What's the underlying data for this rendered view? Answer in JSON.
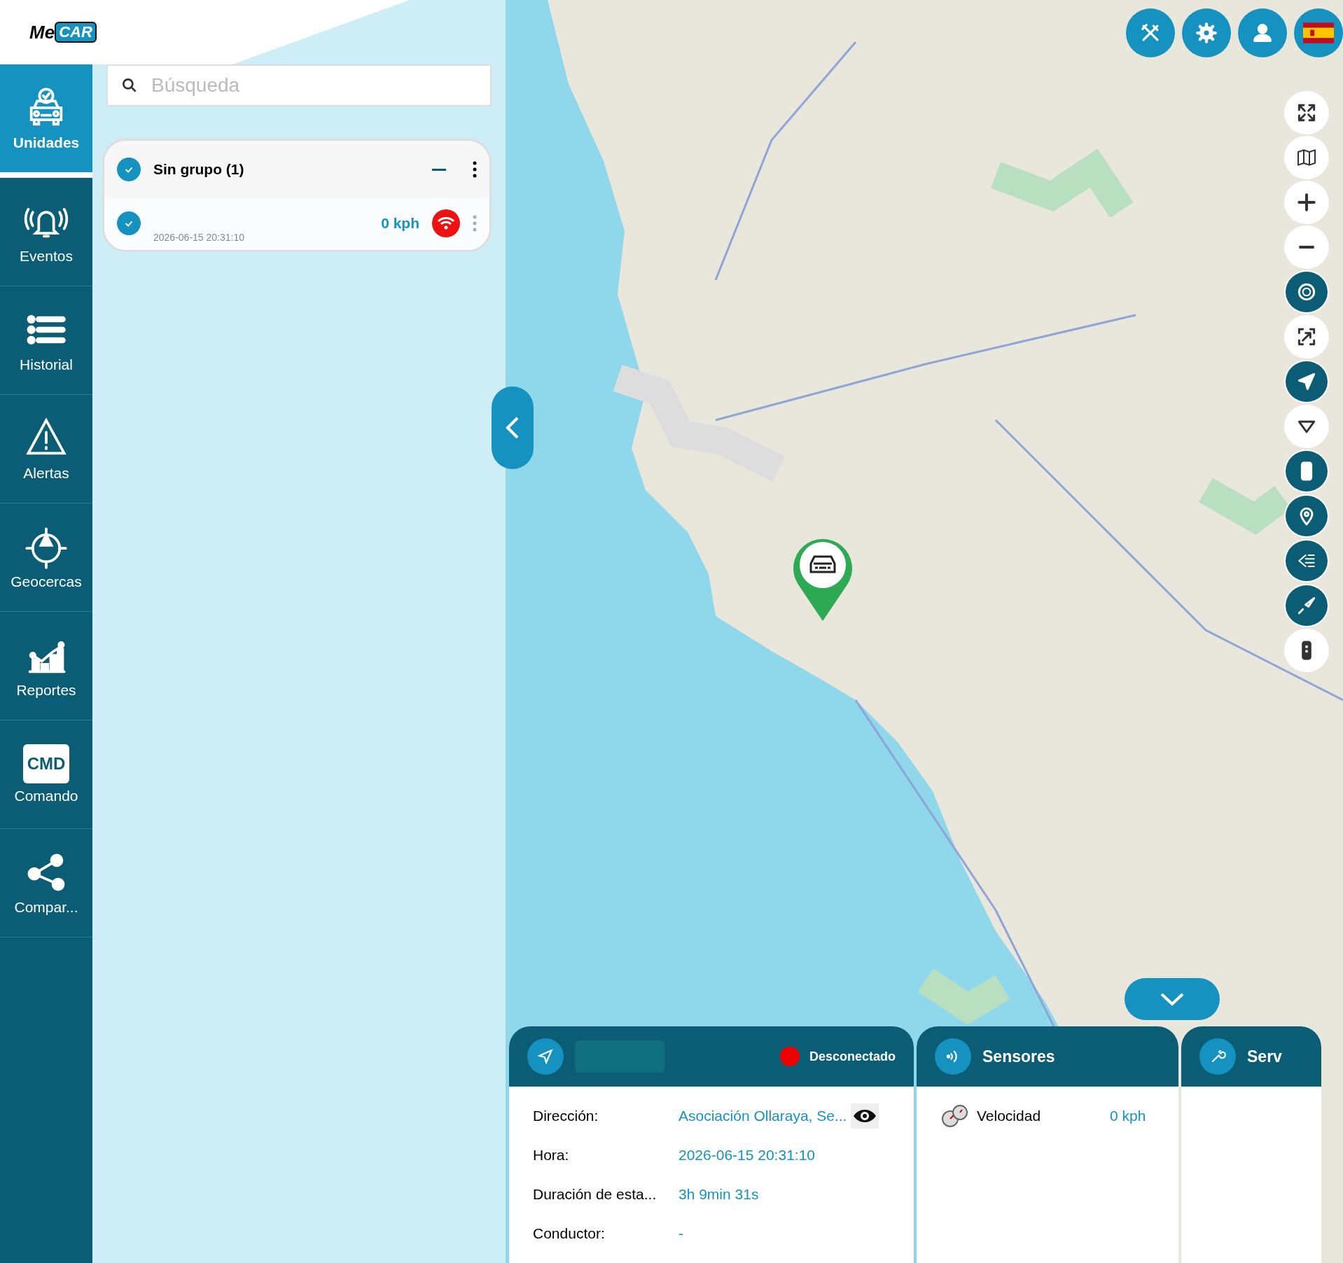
{
  "logo": {
    "prefix": "Me",
    "highlight": "CAR"
  },
  "sidebar": {
    "items": [
      {
        "kind": "units",
        "label": "Unidades",
        "selected": true
      },
      {
        "kind": "events",
        "label": "Eventos",
        "selected": false
      },
      {
        "kind": "history",
        "label": "Historial",
        "selected": false
      },
      {
        "kind": "alerts",
        "label": "Alertas",
        "selected": false
      },
      {
        "kind": "geofences",
        "label": "Geocercas",
        "selected": false
      },
      {
        "kind": "reports",
        "label": "Reportes",
        "selected": false
      },
      {
        "kind": "command",
        "label": "Comando",
        "badge": "CMD",
        "selected": false
      },
      {
        "kind": "share",
        "label": "Compar...",
        "selected": false
      }
    ]
  },
  "search": {
    "placeholder": "Búsqueda"
  },
  "group": {
    "title": "Sin grupo (1)",
    "checked": true,
    "units": [
      {
        "checked": true,
        "time": "2026-06-15 20:31:10",
        "speed": "0 kph",
        "connected": false
      }
    ]
  },
  "top_buttons": [
    {
      "kind": "tools"
    },
    {
      "kind": "settings"
    },
    {
      "kind": "user"
    },
    {
      "kind": "flag"
    }
  ],
  "map_controls": [
    {
      "kind": "fullscreen",
      "on": false
    },
    {
      "kind": "layers",
      "on": false
    },
    {
      "kind": "zoom-in",
      "on": false
    },
    {
      "kind": "zoom-out",
      "on": false
    },
    {
      "kind": "badge",
      "on": true
    },
    {
      "kind": "fit",
      "on": false
    },
    {
      "kind": "navigate",
      "on": true
    },
    {
      "kind": "triangle",
      "on": false
    },
    {
      "kind": "building",
      "on": true
    },
    {
      "kind": "pin",
      "on": true
    },
    {
      "kind": "list",
      "on": true
    },
    {
      "kind": "track",
      "on": true
    },
    {
      "kind": "traffic",
      "on": false
    }
  ],
  "unit_panel": {
    "status": "Desconectado",
    "connected": false,
    "rows": [
      {
        "label": "Dirección:",
        "value": "Asociación Ollaraya, Se...",
        "eye": true
      },
      {
        "label": "Hora:",
        "value": "2026-06-15 20:31:10",
        "eye": false
      },
      {
        "label": "Duración de esta...",
        "value": "3h 9min 31s",
        "eye": false
      },
      {
        "label": "Conductor:",
        "value": "-",
        "eye": false
      }
    ]
  },
  "sensors_panel": {
    "title": "Sensores",
    "rows": [
      {
        "label": "Velocidad",
        "value": "0 kph"
      }
    ]
  },
  "services_panel": {
    "title": "Serv"
  }
}
